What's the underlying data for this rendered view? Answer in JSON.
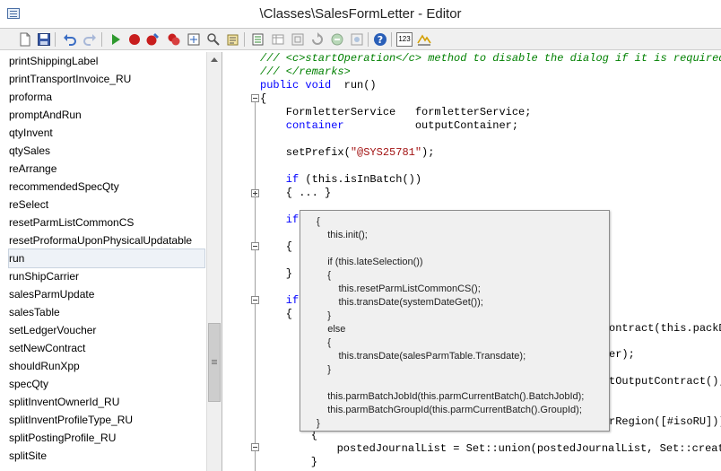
{
  "window": {
    "title": "\\Classes\\SalesFormLetter - Editor"
  },
  "toolbar": {
    "icons": [
      "new-icon",
      "save-icon",
      "undo-icon",
      "redo-icon",
      "run-icon",
      "breakpoint-icon",
      "toggle-breakpoint-icon",
      "remove-breakpoints-icon",
      "compile-icon",
      "lookup-icon",
      "properties-icon",
      "lookup-properties-icon",
      "list-tables-icon",
      "list-classes-icon",
      "list-types-icon",
      "list-enums-icon",
      "label-icon",
      "help-icon",
      "line-number-icon",
      "script-icon"
    ],
    "line_number_label": "123"
  },
  "methods": [
    "printShippingLabel",
    "printTransportInvoice_RU",
    "proforma",
    "promptAndRun",
    "qtyInvent",
    "qtySales",
    "reArrange",
    "recommendedSpecQty",
    "reSelect",
    "resetParmListCommonCS",
    "resetProformaUponPhysicalUpdatable",
    "run",
    "runShipCarrier",
    "salesParmUpdate",
    "salesTable",
    "setLedgerVoucher",
    "setNewContract",
    "shouldRunXpp",
    "specQty",
    "splitInventOwnerId_RU",
    "splitInventProfileType_RU",
    "splitPostingProfile_RU",
    "splitSite"
  ],
  "selected_method": "run",
  "code": {
    "l1": "/// <c>startOperation</c> method to disable the dialog if it is required.",
    "l2": "/// </remarks>",
    "l3_kw": "public void",
    "l3_rest": "  run()",
    "l4": "{",
    "l5": "    FormletterService   formletterService;",
    "l6_kw": "    container",
    "l6_rest": "           outputContainer;",
    "l7_a": "    setPrefix(",
    "l7_str": "\"@SYS25781\"",
    "l7_b": ");",
    "l8_kw": "    if",
    "l8_rest": " (this.isInBatch())",
    "l9": "    { ... }",
    "l10_kw": "    if",
    "l11": "    {",
    "l12": "    }",
    "l13_kw": "    if",
    "l14": "    {",
    "r1": "ontract(this.packDa",
    "r2": "er);",
    "r3": "tOutputContract();",
    "r4": "rRegion([#isoRU]))",
    "l15": "    {",
    "l16": "        postedJournalList = Set::union(postedJournalList, Set::create",
    "l17": "    }"
  },
  "tooltip": {
    "lines": [
      "{",
      "    this.init();",
      "",
      "    if (this.lateSelection())",
      "    {",
      "        this.resetParmListCommonCS();",
      "        this.transDate(systemDateGet());",
      "    }",
      "    else",
      "    {",
      "        this.transDate(salesParmTable.Transdate);",
      "    }",
      "",
      "    this.parmBatchJobId(this.parmCurrentBatch().BatchJobId);",
      "    this.parmBatchGroupId(this.parmCurrentBatch().GroupId);",
      "}"
    ]
  }
}
